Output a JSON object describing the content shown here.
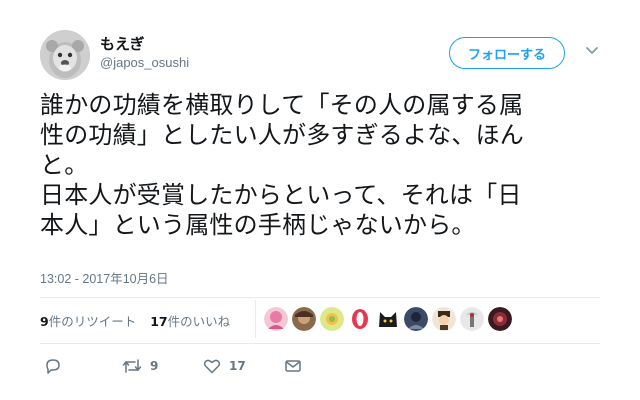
{
  "user": {
    "name": "もえぎ",
    "handle": "@japos_osushi"
  },
  "follow_button": {
    "label": "フォローする"
  },
  "tweet": {
    "lines": [
      "誰かの功績を横取りして「その人の属する属",
      "性の功績」としたい人が多すぎるよな、ほん",
      "と。",
      "日本人が受賞したからといって、それは「日",
      "本人」という属性の手柄じゃないから。"
    ],
    "timestamp": "13:02 - 2017年10月6日"
  },
  "stats": {
    "retweets_count": "9",
    "retweets_label": "件のリツイート",
    "likes_count": "17",
    "likes_label": "件のいいね"
  },
  "likers": [
    {
      "icon": "liker-avatar-1",
      "color": "#e87aa6"
    },
    {
      "icon": "liker-avatar-2",
      "color": "#6b4a2e"
    },
    {
      "icon": "liker-avatar-3",
      "color": "#8fbf4a"
    },
    {
      "icon": "liker-avatar-4",
      "color": "#e63950"
    },
    {
      "icon": "liker-avatar-5",
      "color": "#1c1c1c"
    },
    {
      "icon": "liker-avatar-6",
      "color": "#3d4a66"
    },
    {
      "icon": "liker-avatar-7",
      "color": "#4a3a2a"
    },
    {
      "icon": "liker-avatar-8",
      "color": "#c8c8c8"
    },
    {
      "icon": "liker-avatar-9",
      "color": "#8a2a3a"
    }
  ],
  "actions": {
    "retweet_count": "9",
    "like_count": "17"
  },
  "colors": {
    "accent": "#1da1f2",
    "text": "#14171a",
    "muted": "#657786",
    "divider": "#e6ecf0"
  }
}
